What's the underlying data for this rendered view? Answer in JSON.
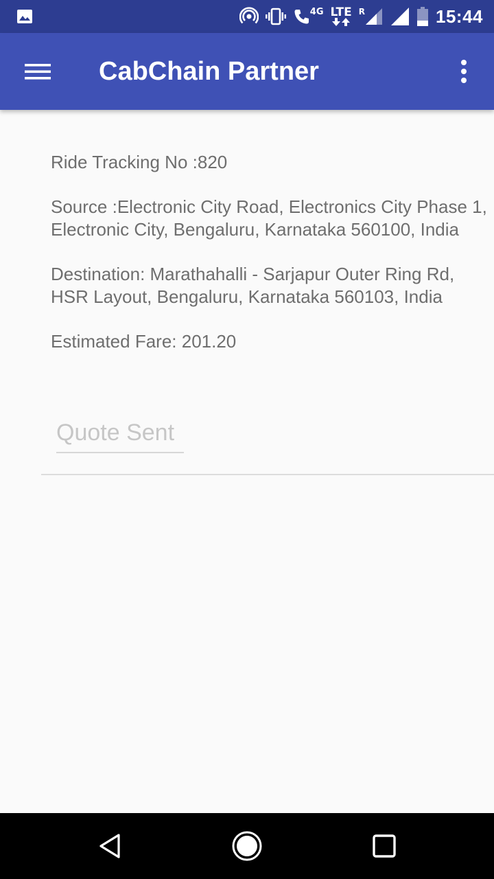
{
  "status_bar": {
    "time": "15:44",
    "network_label": "4G",
    "lte_label": "LTE",
    "roaming_label": "R",
    "icons": [
      "image-notification-icon",
      "hotspot-icon",
      "vibrate-icon",
      "wifi-call-icon",
      "lte-data-icon",
      "signal-icon",
      "signal-icon",
      "battery-icon"
    ]
  },
  "app_bar": {
    "title": "CabChain Partner",
    "menu_icon": "hamburger-menu-icon",
    "overflow_icon": "more-vert-icon"
  },
  "ride": {
    "tracking": "Ride Tracking No :820",
    "source": "Source :Electronic City Road, Electronics City Phase 1, Electronic City, Bengaluru, Karnataka 560100, India",
    "destination": "Destination: Marathahalli - Sarjapur Outer Ring Rd, HSR Layout, Bengaluru, Karnataka 560103, India",
    "fare": "Estimated Fare: 201.20"
  },
  "quote": {
    "value": "Quote Sent"
  },
  "nav_bar": {
    "icons": [
      "back-icon",
      "home-icon",
      "recents-icon"
    ]
  },
  "colors": {
    "status_bar": "#2D3D91",
    "app_bar": "#3F51B5",
    "background": "#FAFAFA",
    "body_text": "#6E6E6E",
    "disabled_text": "#C6C6C6"
  }
}
